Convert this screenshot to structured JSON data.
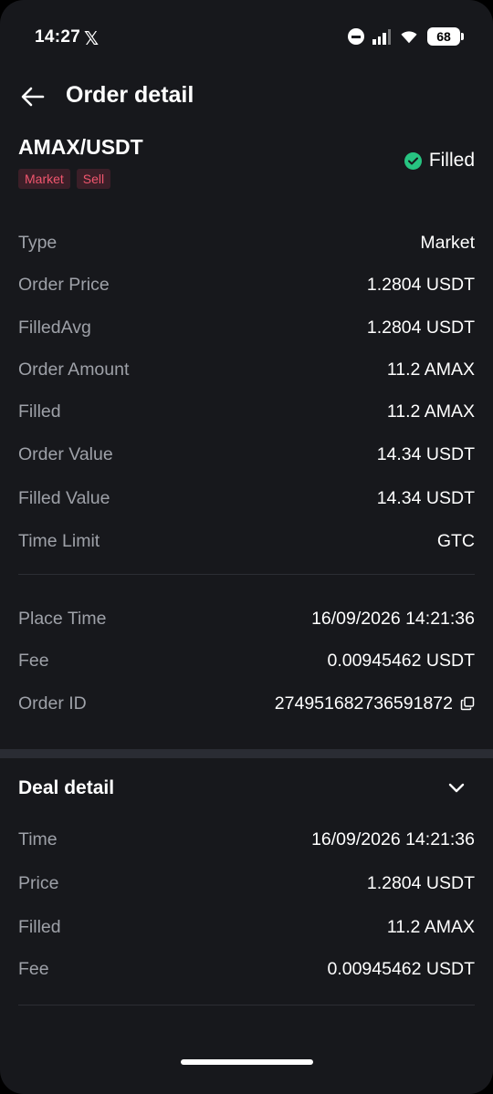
{
  "status_bar": {
    "time": "14:27",
    "social_icon": "x-logo",
    "battery": "68"
  },
  "header": {
    "title": "Order detail"
  },
  "order": {
    "pair": "AMAX/USDT",
    "tags": [
      "Market",
      "Sell"
    ],
    "status": "Filled",
    "status_color": "#27c481",
    "tag_color": "#f0566e"
  },
  "details": [
    {
      "label": "Type",
      "value": "Market"
    },
    {
      "label": "Order Price",
      "value": "1.2804 USDT"
    },
    {
      "label": "FilledAvg",
      "value": "1.2804 USDT"
    },
    {
      "label": "Order Amount",
      "value": "11.2 AMAX"
    },
    {
      "label": "Filled",
      "value": "11.2 AMAX"
    },
    {
      "label": "Order Value",
      "value": "14.34 USDT"
    },
    {
      "label": "Filled Value",
      "value": "14.34 USDT"
    },
    {
      "label": "Time Limit",
      "value": "GTC"
    }
  ],
  "meta": [
    {
      "label": "Place Time",
      "value": "16/09/2026 14:21:36"
    },
    {
      "label": "Fee",
      "value": "0.00945462 USDT"
    },
    {
      "label": "Order ID",
      "value": "274951682736591872"
    }
  ],
  "deal_detail": {
    "title": "Deal detail",
    "rows": [
      {
        "label": "Time",
        "value": "16/09/2026 14:21:36"
      },
      {
        "label": "Price",
        "value": "1.2804 USDT"
      },
      {
        "label": "Filled",
        "value": "11.2 AMAX"
      },
      {
        "label": "Fee",
        "value": "0.00945462 USDT"
      }
    ]
  }
}
